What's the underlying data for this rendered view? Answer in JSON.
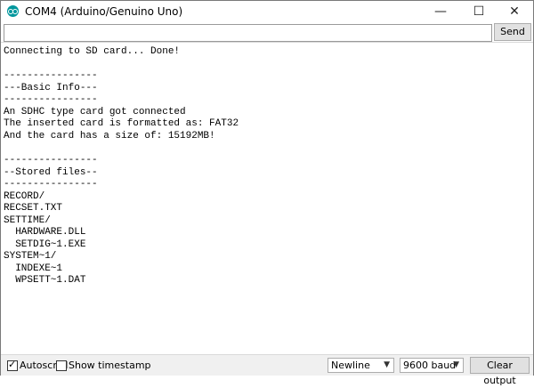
{
  "window": {
    "title": "COM4 (Arduino/Genuino Uno)",
    "controls": {
      "minimize": "—",
      "maximize": "☐",
      "close": "✕"
    }
  },
  "send_row": {
    "input_value": "",
    "send_label": "Send"
  },
  "output": {
    "lines": [
      "Connecting to SD card... Done!",
      "",
      "----------------",
      "---Basic Info---",
      "----------------",
      "An SDHC type card got connected",
      "The inserted card is formatted as: FAT32",
      "And the card has a size of: 15192MB!",
      "",
      "----------------",
      "--Stored files--",
      "----------------",
      "RECORD/",
      "RECSET.TXT",
      "SETTIME/",
      "  HARDWARE.DLL",
      "  SETDIG~1.EXE",
      "SYSTEM~1/",
      "  INDEXE~1",
      "  WPSETT~1.DAT"
    ]
  },
  "bottom_bar": {
    "autoscroll": {
      "label": "Autoscroll",
      "checked": true
    },
    "show_timestamp": {
      "label": "Show timestamp",
      "checked": false
    },
    "line_ending": "Newline",
    "baud_rate": "9600 baud",
    "clear_label": "Clear output"
  },
  "colors": {
    "app_icon": "#00979d",
    "button_bg": "#e1e1e1"
  }
}
